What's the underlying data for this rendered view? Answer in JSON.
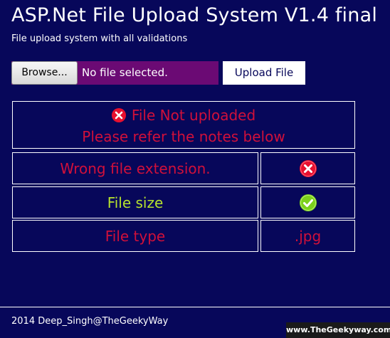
{
  "header": {
    "title": "ASP.Net File Upload System V1.4 final",
    "subtitle": "File upload system with all validations"
  },
  "upload_form": {
    "browse_label": "Browse...",
    "file_status": "No file selected.",
    "upload_label": "Upload File"
  },
  "result": {
    "status_line1": "File Not uploaded",
    "status_line2": "Please refer the notes below",
    "status_icon": "error-icon",
    "checks": [
      {
        "label": "Wrong file extension.",
        "value_icon": "error-icon",
        "passed": false
      },
      {
        "label": "File size",
        "value_icon": "check-icon",
        "passed": true
      },
      {
        "label": "File type",
        "value": ".jpg",
        "passed": false
      }
    ]
  },
  "colors": {
    "background": "#07075a",
    "error_text": "#d0103a",
    "success_text": "#b6e22e",
    "file_input_bg": "#6b0a74",
    "error_icon": "#e8102f",
    "success_icon": "#7cd11c"
  },
  "footer": {
    "copyright": "2014 Deep_Singh@TheGeekyWay",
    "watermark": "www.TheGeekyway.com"
  }
}
